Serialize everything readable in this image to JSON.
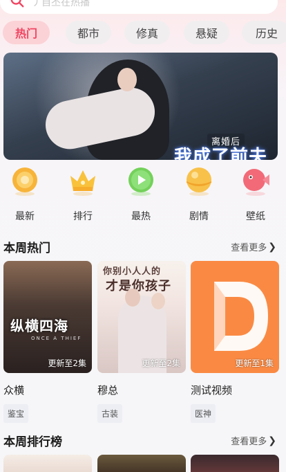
{
  "search": {
    "placeholder": "丿自丕在热播"
  },
  "tabs": [
    {
      "label": "热门",
      "active": true
    },
    {
      "label": "都市",
      "active": false
    },
    {
      "label": "修真",
      "active": false
    },
    {
      "label": "悬疑",
      "active": false
    },
    {
      "label": "历史",
      "active": false
    }
  ],
  "banner": {
    "subtitle": "离婚后",
    "title": "我成了前夫的白月光"
  },
  "categories": [
    {
      "label": "最新",
      "icon": "coin-icon",
      "color": "#f7b43a"
    },
    {
      "label": "排行",
      "icon": "crown-icon",
      "color": "#f9c23c"
    },
    {
      "label": "最热",
      "icon": "play-icon",
      "color": "#74d15b"
    },
    {
      "label": "剧情",
      "icon": "ball-icon",
      "color": "#f8c14a"
    },
    {
      "label": "壁纸",
      "icon": "fish-icon",
      "color": "#f26a78"
    }
  ],
  "weekly_hot": {
    "title": "本周热门",
    "more": "查看更多",
    "items": [
      {
        "name": "众横",
        "tag": "鉴宝",
        "update": "更新至2集",
        "poster_text": "纵横四海",
        "poster_sub": "ONCE A THIEF"
      },
      {
        "name": "穆总",
        "tag": "古装",
        "update": "更新至2集",
        "poster_text_top": "你别小人人的",
        "poster_text_bottom": "才是你孩子"
      },
      {
        "name": "测试视频",
        "tag": "医神",
        "update": "更新至1集"
      }
    ]
  },
  "weekly_rank": {
    "title": "本周排行榜",
    "more": "查看更多"
  },
  "colors": {
    "accent": "#f04561",
    "tab_active_bg": "#fbd2d6"
  }
}
